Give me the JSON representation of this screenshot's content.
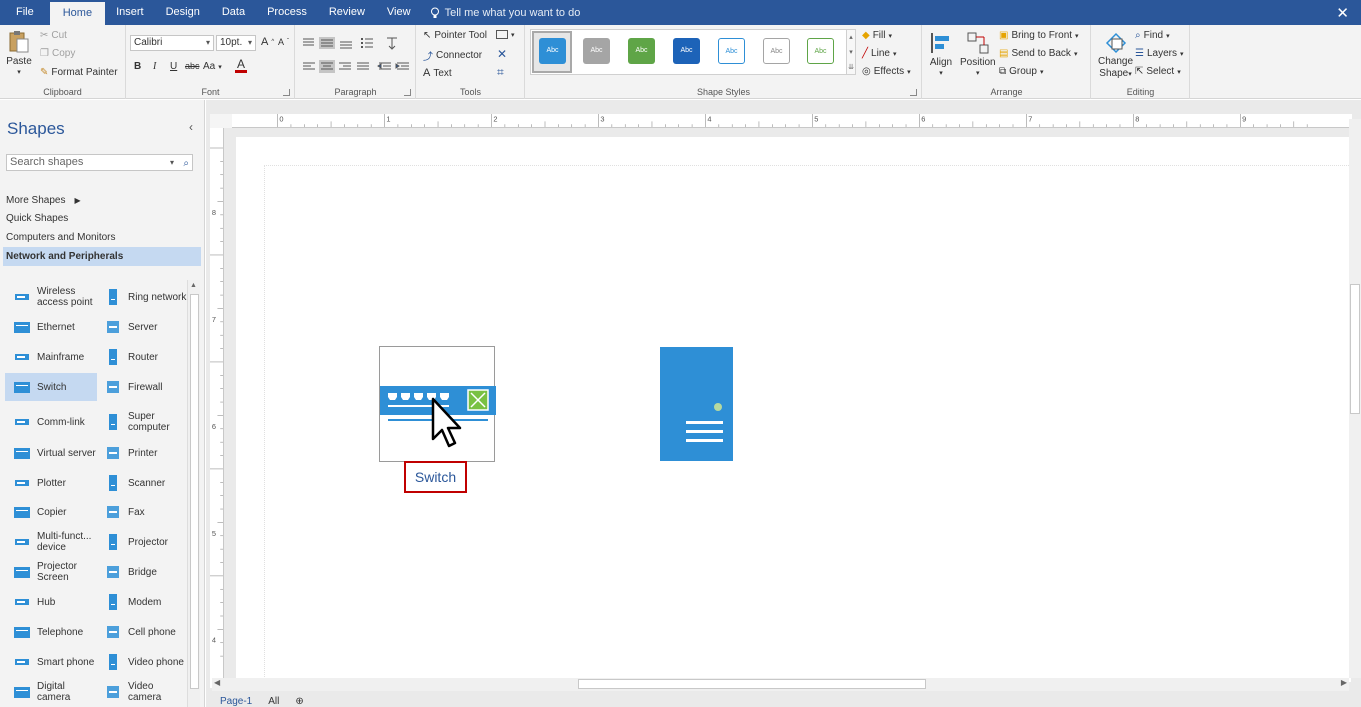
{
  "menubar": {
    "tabs": [
      "File",
      "Home",
      "Insert",
      "Design",
      "Data",
      "Process",
      "Review",
      "View"
    ],
    "active_tab": "Home",
    "tell_me": "Tell me what you want to do"
  },
  "ribbon": {
    "clipboard": {
      "label": "Clipboard",
      "paste": "Paste",
      "cut": "Cut",
      "copy": "Copy",
      "format_painter": "Format Painter"
    },
    "font": {
      "label": "Font",
      "font_name": "Calibri",
      "font_size": "10pt.",
      "bold": "B",
      "italic": "I",
      "underline": "U",
      "strike": "abc",
      "case": "Aa"
    },
    "paragraph": {
      "label": "Paragraph"
    },
    "tools": {
      "label": "Tools",
      "pointer": "Pointer Tool",
      "connector": "Connector",
      "text": "Text"
    },
    "shape_styles": {
      "label": "Shape Styles",
      "swatch_text": "Abc",
      "fill": "Fill",
      "line": "Line",
      "effects": "Effects"
    },
    "arrange": {
      "label": "Arrange",
      "align": "Align",
      "position": "Position",
      "bring_front": "Bring to Front",
      "send_back": "Send to Back",
      "group": "Group"
    },
    "editing": {
      "label": "Editing",
      "change_shape_1": "Change",
      "change_shape_2": "Shape",
      "find": "Find",
      "layers": "Layers",
      "select": "Select"
    }
  },
  "shapes_pane": {
    "title": "Shapes",
    "search_placeholder": "Search shapes",
    "links": [
      "More Shapes",
      "Quick Shapes",
      "Computers and Monitors",
      "Network and Peripherals"
    ],
    "items": [
      [
        "Wireless access point",
        "Ring network"
      ],
      [
        "Ethernet",
        "Server"
      ],
      [
        "Mainframe",
        "Router"
      ],
      [
        "Switch",
        "Firewall"
      ],
      [
        "Comm-link",
        "Super computer"
      ],
      [
        "Virtual server",
        "Printer"
      ],
      [
        "Plotter",
        "Scanner"
      ],
      [
        "Copier",
        "Fax"
      ],
      [
        "Multi-funct... device",
        "Projector"
      ],
      [
        "Projector Screen",
        "Bridge"
      ],
      [
        "Hub",
        "Modem"
      ],
      [
        "Telephone",
        "Cell phone"
      ],
      [
        "Smart phone",
        "Video phone"
      ],
      [
        "Digital camera",
        "Video camera"
      ]
    ]
  },
  "canvas": {
    "ruler_numbers_h": [
      "0",
      "1",
      "2",
      "3",
      "4",
      "5",
      "6",
      "7",
      "8",
      "9"
    ],
    "ruler_numbers_v": [
      "8",
      "7",
      "6",
      "5",
      "4"
    ],
    "switch_label": "Switch",
    "page_tab": "Page-1",
    "all_tab": "All"
  },
  "colors": {
    "brand": "#2b579a",
    "shape_blue": "#2e8fd6",
    "highlight": "#c00000",
    "selection": "#c5d9f1"
  }
}
